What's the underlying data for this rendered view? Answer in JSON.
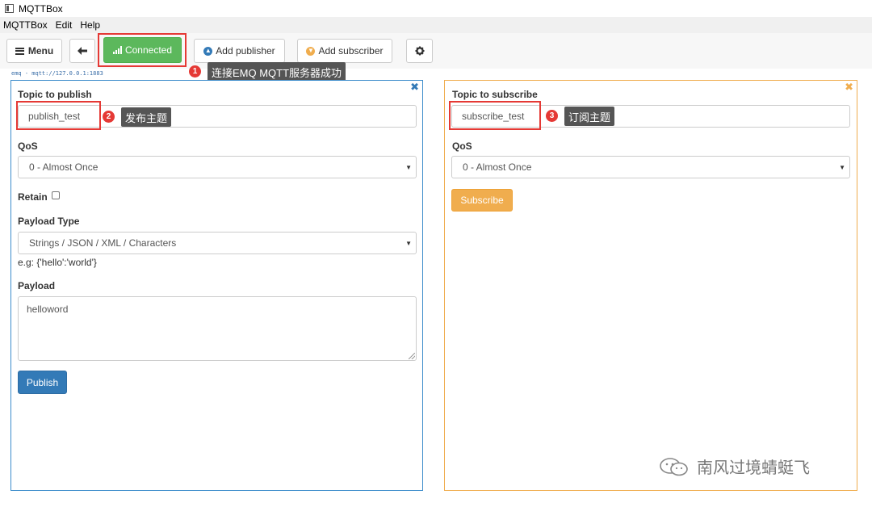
{
  "window": {
    "title": "MQTTBox"
  },
  "menubar": {
    "items": [
      "MQTTBox",
      "Edit",
      "Help"
    ]
  },
  "toolbar": {
    "menu_label": "Menu",
    "connected_label": "Connected",
    "add_publisher_label": "Add publisher",
    "add_subscriber_label": "Add subscriber"
  },
  "connection": {
    "label": "emq - mqtt://127.0.0.1:1883"
  },
  "publisher": {
    "topic_label": "Topic to publish",
    "topic_value": "publish_test",
    "qos_label": "QoS",
    "qos_value": "0 - Almost Once",
    "retain_label": "Retain",
    "retain_checked": false,
    "payload_type_label": "Payload Type",
    "payload_type_value": "Strings / JSON / XML / Characters",
    "payload_hint": "e.g: {'hello':'world'}",
    "payload_label": "Payload",
    "payload_value": "helloword",
    "publish_button": "Publish",
    "border_color": "#3b8ccb"
  },
  "subscriber": {
    "topic_label": "Topic to subscribe",
    "topic_value": "subscribe_test",
    "qos_label": "QoS",
    "qos_value": "0 - Almost Once",
    "subscribe_button": "Subscribe",
    "border_color": "#f0ad4e"
  },
  "annotations": [
    {
      "number": "1",
      "text": "连接EMQ MQTT服务器成功"
    },
    {
      "number": "2",
      "text": "发布主题"
    },
    {
      "number": "3",
      "text": "订阅主题"
    }
  ],
  "watermark": {
    "text": "南风过境蜻蜓飞"
  },
  "colors": {
    "success": "#5cb85c",
    "primary": "#337ab7",
    "warning": "#f0ad4e",
    "annotation_red": "#e53935"
  }
}
